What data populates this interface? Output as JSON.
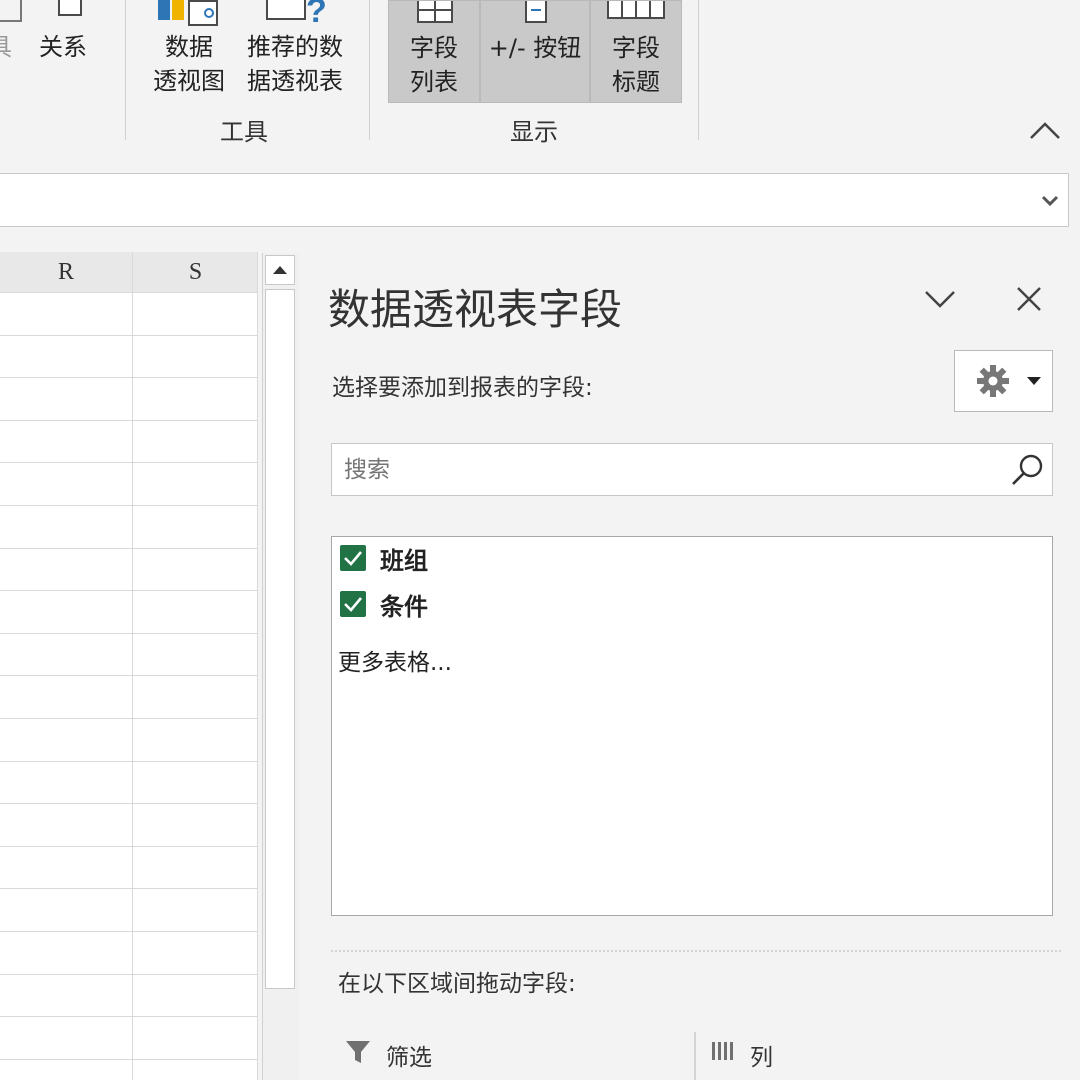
{
  "ribbon": {
    "partial_label": "具",
    "relations_label": "关系",
    "pivot_chart_label_1": "数据",
    "pivot_chart_label_2": "透视图",
    "recommended_label_1": "推荐的数",
    "recommended_label_2": "据透视表",
    "tools_group_label": "工具",
    "field_list_label_1": "字段",
    "field_list_label_2": "列表",
    "buttons_label": "+/- 按钮",
    "field_headers_label_1": "字段",
    "field_headers_label_2": "标题",
    "show_group_label": "显示"
  },
  "grid": {
    "columns": [
      "R",
      "S"
    ]
  },
  "pane": {
    "title": "数据透视表字段",
    "choose_label": "选择要添加到报表的字段:",
    "search_placeholder": "搜索",
    "fields": [
      {
        "label": "班组",
        "checked": true
      },
      {
        "label": "条件",
        "checked": true
      }
    ],
    "more_tables": "更多表格...",
    "drag_label": "在以下区域间拖动字段:",
    "areas": {
      "filters": "筛选",
      "columns": "列"
    }
  },
  "colors": {
    "accent": "#217346",
    "show_active": "#c9c9c9"
  }
}
